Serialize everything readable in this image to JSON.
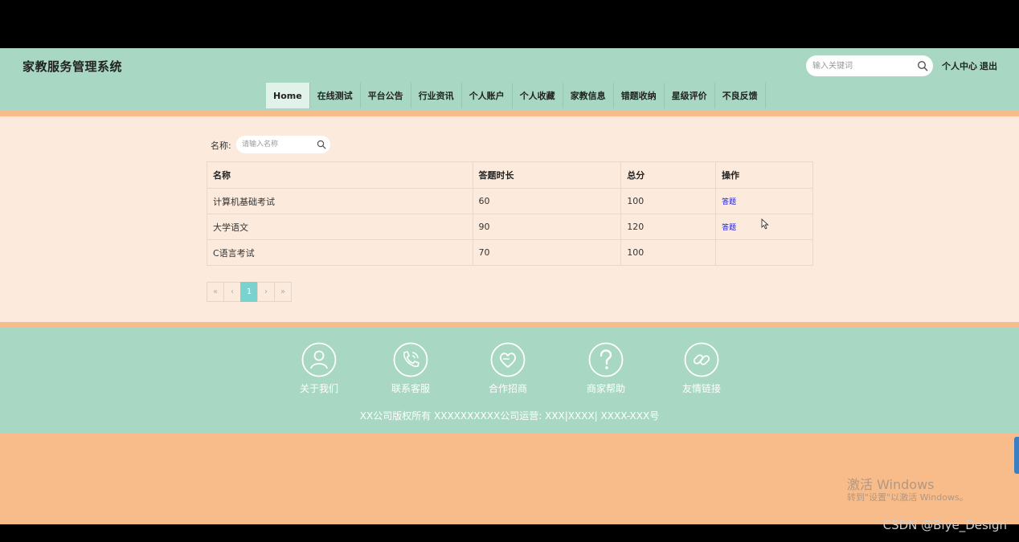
{
  "header": {
    "title": "家教服务管理系统",
    "search_placeholder": "输入关键词",
    "user_center": "个人中心",
    "logout": "退出"
  },
  "nav": {
    "items": [
      {
        "label": "Home"
      },
      {
        "label": "在线测试"
      },
      {
        "label": "平台公告"
      },
      {
        "label": "行业资讯"
      },
      {
        "label": "个人账户"
      },
      {
        "label": "个人收藏"
      },
      {
        "label": "家教信息"
      },
      {
        "label": "错题收纳"
      },
      {
        "label": "星级评价"
      },
      {
        "label": "不良反馈"
      }
    ],
    "active": "Home"
  },
  "filter": {
    "label": "名称:",
    "placeholder": "请输入名称"
  },
  "table": {
    "headers": [
      "名称",
      "答题时长",
      "总分",
      "操作"
    ],
    "rows": [
      {
        "name": "计算机基础考试",
        "duration": "60",
        "score": "100",
        "action": "答题"
      },
      {
        "name": "大学语文",
        "duration": "90",
        "score": "120",
        "action": "答题"
      },
      {
        "name": "C语言考试",
        "duration": "70",
        "score": "100",
        "action": ""
      }
    ]
  },
  "pagination": {
    "first": "«",
    "prev": "‹",
    "current": "1",
    "next": "›",
    "last": "»"
  },
  "footer": {
    "links": [
      {
        "label": "关于我们",
        "icon": "user-icon"
      },
      {
        "label": "联系客服",
        "icon": "phone-icon"
      },
      {
        "label": "合作招商",
        "icon": "heart-icon"
      },
      {
        "label": "商家帮助",
        "icon": "help-icon"
      },
      {
        "label": "友情链接",
        "icon": "link-icon"
      }
    ],
    "copyright": "XX公司版权所有 XXXXXXXXXX公司运营: XXX|XXXX| XXXX-XXX号"
  },
  "os_overlay": {
    "activate_title": "激活 Windows",
    "activate_sub": "转到\"设置\"以激活 Windows。",
    "watermark": "CSDN @Biye_Design"
  },
  "colors": {
    "header_bg": "#a8d8c3",
    "accent_orange": "#f8bc8a",
    "main_bg": "#fcebdd",
    "page_active": "#78d2ce",
    "link": "#1a1acc"
  }
}
